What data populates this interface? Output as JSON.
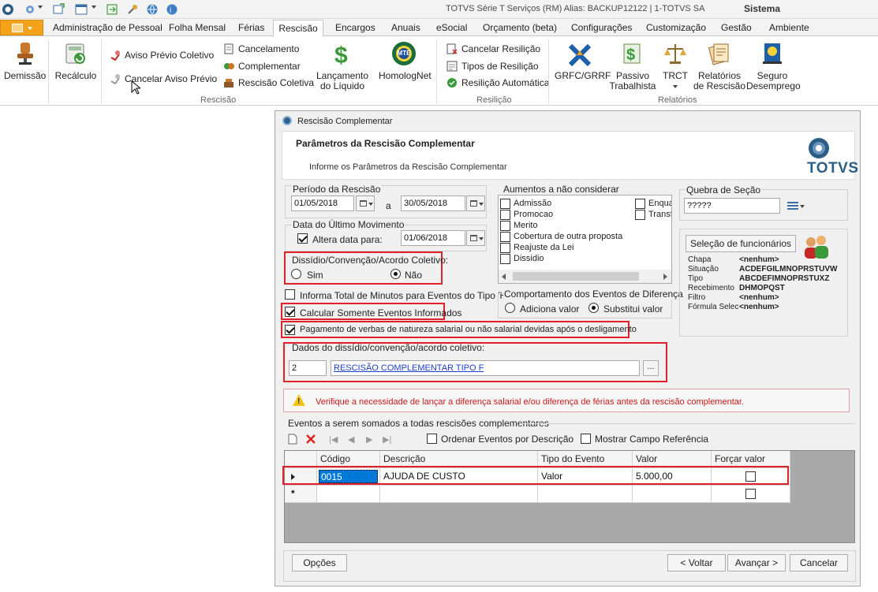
{
  "titlebar": {
    "title": "TOTVS Série T Serviços (RM) Alias: BACKUP12122 | 1-TOTVS SA",
    "right": "Sistema"
  },
  "tabs": [
    "Administração de Pessoal",
    "Folha Mensal",
    "Férias",
    "Rescisão",
    "Encargos",
    "Anuais",
    "eSocial",
    "Orçamento (beta)",
    "Configurações",
    "Customização",
    "Gestão",
    "Ambiente"
  ],
  "ribbon": {
    "demissao": "Demissão",
    "recalculo": "Recálculo",
    "aviso_previo_coletivo": "Aviso Prévio Coletivo",
    "cancelar_aviso_previo": "Cancelar Aviso Prévio",
    "cancelamento": "Cancelamento",
    "complementar": "Complementar",
    "rescisao_coletiva": "Rescisão Coletiva",
    "lancamento_line1": "Lançamento",
    "lancamento_line2": "do Líquido",
    "homolognet": "HomologNet",
    "mte_badge": "MTE",
    "cancelar_resilicao": "Cancelar Resilição",
    "tipos_resilicao": "Tipos de Resilição",
    "resilicao_automatica": "Resilição Automática",
    "grfc": "GRFC/GRRF",
    "passivo_line1": "Passivo",
    "passivo_line2": "Trabalhista",
    "trct": "TRCT",
    "relatorios_line1": "Relatórios",
    "relatorios_line2": "de Rescisão",
    "seguro_line1": "Seguro",
    "seguro_line2": "Desemprego",
    "group_rescisao": "Rescisão",
    "group_resilicao": "Resilição",
    "group_relatorios": "Relatórios"
  },
  "dialog": {
    "title": "Rescisão Complementar",
    "header_title": "Parâmetros da Rescisão Complementar",
    "header_subtitle": "Informe os Parâmetros da Rescisão Complementar",
    "logo_text": "TOTVS",
    "periodo_label": "Período da Rescisão",
    "periodo_inicio": "01/05/2018",
    "periodo_sep": "a",
    "periodo_fim": "30/05/2018",
    "ultimo_mov_label": "Data do Último Movimento",
    "altera_data_label": "Altera data para:",
    "altera_data_value": "01/06/2018",
    "dissidio_label": "Dissídio/Convenção/Acordo Coletivo:",
    "sim": "Sim",
    "nao": "Não",
    "informa_total": "Informa Total de Minutos para Eventos do Tipo 'H'",
    "calcular_somente": "Calcular Somente Eventos Informados",
    "pagamento_verbas": "Pagamento de verbas de natureza salarial ou não salarial devidas após o desligamento",
    "dados_dissidio_label": "Dados do dissídio/convenção/acordo coletivo:",
    "dados_codigo": "2",
    "dados_descricao": "RESCISÃO COMPLEMENTAR TIPO F",
    "ellipsis": "...",
    "aumentos_label": "Aumentos a não considerar",
    "aumentos_col1": [
      "Admissão",
      "Promocao",
      "Merito",
      "Cobertura de outra proposta",
      "Reajuste da Lei",
      "Dissidio"
    ],
    "aumentos_col2": [
      "Enqua",
      "Transf"
    ],
    "comportamento_label": "Comportamento dos Eventos de Diferença",
    "adiciona_valor": "Adiciona valor",
    "substitui_valor": "Substitui valor",
    "quebra_label": "Quebra de Seção",
    "quebra_value": "?????",
    "selecao_button": "Seleção de funcionários",
    "selecao_rows": [
      {
        "k": "Chapa",
        "v": "<nenhum>"
      },
      {
        "k": "Situação",
        "v": "ACDEFGILMNOPRSTUVW"
      },
      {
        "k": "Tipo",
        "v": "ABCDEFIMNOPRSTUXZ"
      },
      {
        "k": "Recebimento",
        "v": "DHMOPQST"
      },
      {
        "k": "Filtro",
        "v": "<nenhum>"
      },
      {
        "k": "Fórmula Selec",
        "v": "<nenhum>"
      }
    ],
    "warning": "Verifique a necessidade de lançar a diferença salarial e/ou diferença de férias antes da rescisão complementar.",
    "eventos_label": "Eventos a serem somados a todas rescisões complementares",
    "ordenar_label": "Ordenar Eventos por Descrição",
    "mostrar_label": "Mostrar Campo Referência",
    "grid_headers": [
      "Código",
      "Descrição",
      "Tipo do Evento",
      "Valor",
      "Forçar valor"
    ],
    "grid_row": {
      "codigo": "0015",
      "descricao": "AJUDA DE CUSTO",
      "tipo": "Valor",
      "valor": "5.000,00"
    },
    "new_row_marker": "*",
    "btn_opcoes": "Opções",
    "btn_voltar": "< Voltar",
    "btn_avancar": "Avançar >",
    "btn_cancelar": "Cancelar"
  }
}
